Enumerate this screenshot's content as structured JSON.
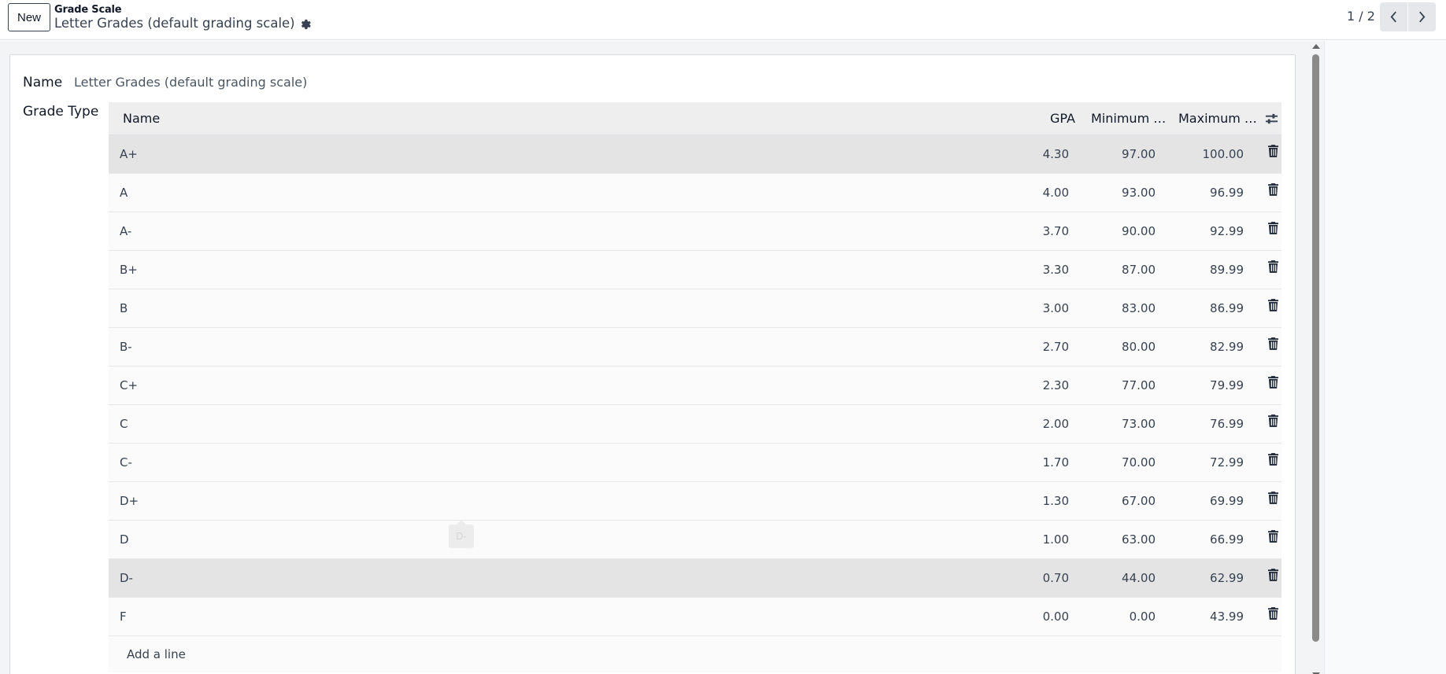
{
  "control_panel": {
    "new_label": "New",
    "breadcrumb": "Grade Scale",
    "record_title": "Letter Grades (default grading scale)",
    "pager_value": "1 / 2"
  },
  "form": {
    "name_label": "Name",
    "name_value": "Letter Grades (default grading scale)",
    "grade_type_label": "Grade Type"
  },
  "list": {
    "columns": {
      "name": "Name",
      "gpa": "GPA",
      "min": "Minimum P...",
      "max": "Maximum P..."
    },
    "rows": [
      {
        "name": "A+",
        "gpa": "4.30",
        "min": "97.00",
        "max": "100.00"
      },
      {
        "name": "A",
        "gpa": "4.00",
        "min": "93.00",
        "max": "96.99"
      },
      {
        "name": "A-",
        "gpa": "3.70",
        "min": "90.00",
        "max": "92.99"
      },
      {
        "name": "B+",
        "gpa": "3.30",
        "min": "87.00",
        "max": "89.99"
      },
      {
        "name": "B",
        "gpa": "3.00",
        "min": "83.00",
        "max": "86.99"
      },
      {
        "name": "B-",
        "gpa": "2.70",
        "min": "80.00",
        "max": "82.99"
      },
      {
        "name": "C+",
        "gpa": "2.30",
        "min": "77.00",
        "max": "79.99"
      },
      {
        "name": "C",
        "gpa": "2.00",
        "min": "73.00",
        "max": "76.99"
      },
      {
        "name": "C-",
        "gpa": "1.70",
        "min": "70.00",
        "max": "72.99"
      },
      {
        "name": "D+",
        "gpa": "1.30",
        "min": "67.00",
        "max": "69.99"
      },
      {
        "name": "D",
        "gpa": "1.00",
        "min": "63.00",
        "max": "66.99"
      },
      {
        "name": "D-",
        "gpa": "0.70",
        "min": "44.00",
        "max": "62.99"
      },
      {
        "name": "F",
        "gpa": "0.00",
        "min": "0.00",
        "max": "43.99"
      }
    ],
    "add_line_label": "Add a line",
    "drag_ghost": "D-"
  },
  "icons": {
    "gear": "gear-icon",
    "prev": "chevron-left-icon",
    "next": "chevron-right-icon",
    "trash": "trash-icon",
    "optional_columns": "sliders-icon"
  },
  "colors": {
    "highlight_row": "#e4e4e4",
    "header_bg": "#eeeeee",
    "content_bg": "#f2f4f6"
  }
}
